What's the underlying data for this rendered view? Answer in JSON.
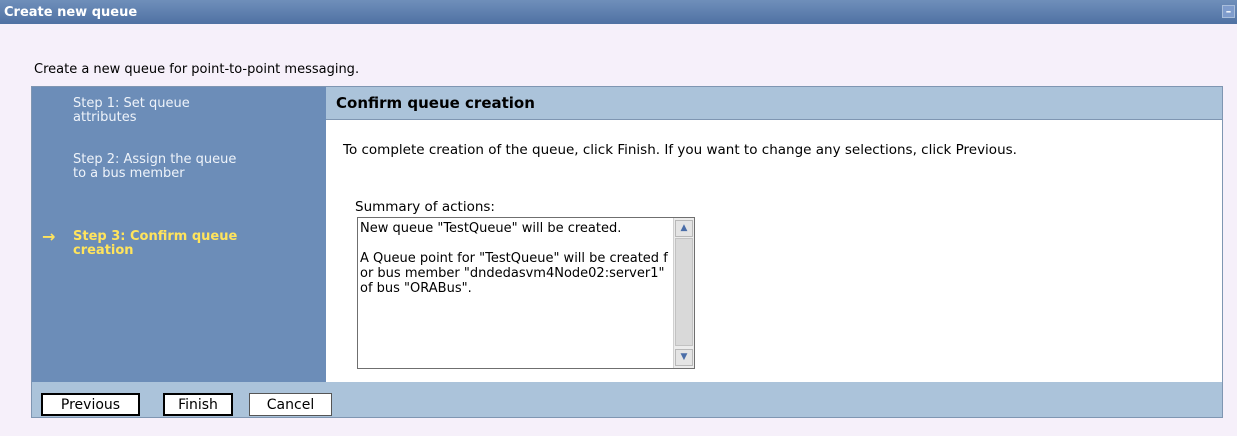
{
  "window": {
    "title": "Create new queue",
    "collapse_symbol": "–"
  },
  "page": {
    "description": "Create a new queue for point-to-point messaging."
  },
  "steps": [
    {
      "label": "Step 1: Set queue attributes"
    },
    {
      "label": "Step 2: Assign the queue to a bus member"
    },
    {
      "label": "Step 3: Confirm queue creation",
      "current": true
    }
  ],
  "current_step_marker": "→",
  "panel": {
    "title": "Confirm queue creation",
    "instructions": "To complete creation of the queue, click Finish. If you want to change any selections, click Previous.",
    "summary_label": "Summary of actions:",
    "summary_text": "New queue \"TestQueue\" will be created.\n\nA Queue point for \"TestQueue\" will be created for bus member \"dndedasvm4Node02:server1\" of bus \"ORABus\"."
  },
  "buttons": {
    "previous": "Previous",
    "finish": "Finish",
    "cancel": "Cancel"
  },
  "icons": {
    "scroll_up": "▲",
    "scroll_down": "▼"
  },
  "colors": {
    "titlebar": "#5a7aad",
    "step_panel": "#6c8db8",
    "current_step": "#ffe45c",
    "header_band": "#abc3da",
    "page_background": "#f6f0fa"
  }
}
